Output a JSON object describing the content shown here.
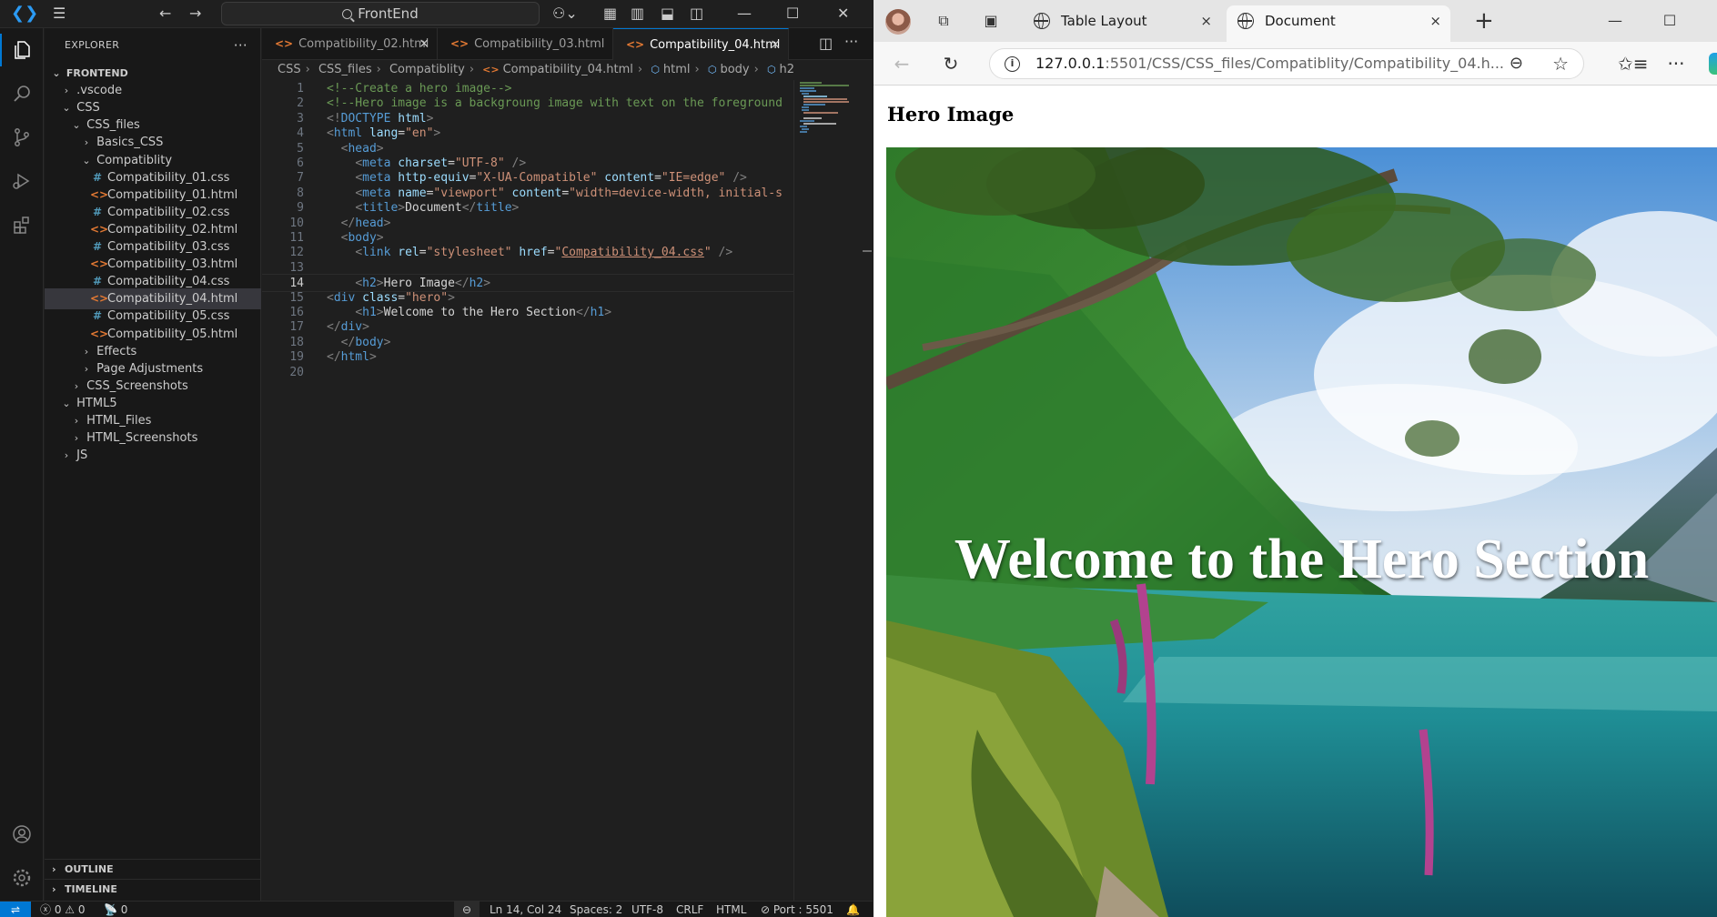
{
  "vscode": {
    "command_center": "FrontEnd",
    "sidebar": {
      "title": "EXPLORER",
      "tree": [
        {
          "label": "FRONTEND",
          "kind": "root",
          "chev": "⌄"
        },
        {
          "label": ".vscode",
          "kind": "folder",
          "chev": "›"
        },
        {
          "label": "CSS",
          "kind": "folder",
          "chev": "⌄"
        },
        {
          "label": "CSS_files",
          "kind": "folder",
          "chev": "⌄"
        },
        {
          "label": "Basics_CSS",
          "kind": "folder",
          "chev": "›"
        },
        {
          "label": "Compatiblity",
          "kind": "folder",
          "chev": "⌄"
        },
        {
          "label": "Compatibility_01.css",
          "kind": "css"
        },
        {
          "label": "Compatibility_01.html",
          "kind": "html"
        },
        {
          "label": "Compatibility_02.css",
          "kind": "css"
        },
        {
          "label": "Compatibility_02.html",
          "kind": "html"
        },
        {
          "label": "Compatibility_03.css",
          "kind": "css"
        },
        {
          "label": "Compatibility_03.html",
          "kind": "html"
        },
        {
          "label": "Compatibility_04.css",
          "kind": "css"
        },
        {
          "label": "Compatibility_04.html",
          "kind": "html",
          "selected": true
        },
        {
          "label": "Compatibility_05.css",
          "kind": "css"
        },
        {
          "label": "Compatibility_05.html",
          "kind": "html"
        },
        {
          "label": "Effects",
          "kind": "folder",
          "chev": "›"
        },
        {
          "label": "Page Adjustments",
          "kind": "folder",
          "chev": "›"
        },
        {
          "label": "CSS_Screenshots",
          "kind": "folder",
          "chev": "›"
        },
        {
          "label": "HTML5",
          "kind": "folder",
          "chev": "⌄"
        },
        {
          "label": "HTML_Files",
          "kind": "folder",
          "chev": "›"
        },
        {
          "label": "HTML_Screenshots",
          "kind": "folder",
          "chev": "›"
        },
        {
          "label": "JS",
          "kind": "folder",
          "chev": "›"
        }
      ],
      "outline": "OUTLINE",
      "timeline": "TIMELINE"
    },
    "tabs": [
      {
        "label": "Compatibility_02.html",
        "close": "×"
      },
      {
        "label": "Compatibility_03.html",
        "close": ""
      },
      {
        "label": "Compatibility_04.html",
        "close": "×",
        "active": true
      }
    ],
    "breadcrumbs": [
      "CSS",
      "CSS_files",
      "Compatiblity",
      "Compatibility_04.html",
      "html",
      "body",
      "h2"
    ],
    "code_lines": [
      [
        [
          "c-com",
          "<!--Create a hero image-->"
        ]
      ],
      [
        [
          "c-com",
          "<!--Hero image is a backgroung image with text on the foreground"
        ]
      ],
      [
        [
          "c-brk",
          "<!"
        ],
        [
          "c-tag",
          "DOCTYPE"
        ],
        [
          "c-txt",
          " "
        ],
        [
          "c-att",
          "html"
        ],
        [
          "c-brk",
          ">"
        ]
      ],
      [
        [
          "c-brk",
          "<"
        ],
        [
          "c-tag",
          "html"
        ],
        [
          "c-txt",
          " "
        ],
        [
          "c-att",
          "lang"
        ],
        [
          "c-txt",
          "="
        ],
        [
          "c-str",
          "\"en\""
        ],
        [
          "c-brk",
          ">"
        ]
      ],
      [
        [
          "c-txt",
          "  "
        ],
        [
          "c-brk",
          "<"
        ],
        [
          "c-tag",
          "head"
        ],
        [
          "c-brk",
          ">"
        ]
      ],
      [
        [
          "c-txt",
          "    "
        ],
        [
          "c-brk",
          "<"
        ],
        [
          "c-tag",
          "meta"
        ],
        [
          "c-txt",
          " "
        ],
        [
          "c-att",
          "charset"
        ],
        [
          "c-txt",
          "="
        ],
        [
          "c-str",
          "\"UTF-8\""
        ],
        [
          "c-txt",
          " "
        ],
        [
          "c-brk",
          "/>"
        ]
      ],
      [
        [
          "c-txt",
          "    "
        ],
        [
          "c-brk",
          "<"
        ],
        [
          "c-tag",
          "meta"
        ],
        [
          "c-txt",
          " "
        ],
        [
          "c-att",
          "http-equiv"
        ],
        [
          "c-txt",
          "="
        ],
        [
          "c-str",
          "\"X-UA-Compatible\""
        ],
        [
          "c-txt",
          " "
        ],
        [
          "c-att",
          "content"
        ],
        [
          "c-txt",
          "="
        ],
        [
          "c-str",
          "\"IE=edge\""
        ],
        [
          "c-txt",
          " "
        ],
        [
          "c-brk",
          "/>"
        ]
      ],
      [
        [
          "c-txt",
          "    "
        ],
        [
          "c-brk",
          "<"
        ],
        [
          "c-tag",
          "meta"
        ],
        [
          "c-txt",
          " "
        ],
        [
          "c-att",
          "name"
        ],
        [
          "c-txt",
          "="
        ],
        [
          "c-str",
          "\"viewport\""
        ],
        [
          "c-txt",
          " "
        ],
        [
          "c-att",
          "content"
        ],
        [
          "c-txt",
          "="
        ],
        [
          "c-str",
          "\"width=device-width, initial-s"
        ]
      ],
      [
        [
          "c-txt",
          "    "
        ],
        [
          "c-brk",
          "<"
        ],
        [
          "c-tag",
          "title"
        ],
        [
          "c-brk",
          ">"
        ],
        [
          "c-txt",
          "Document"
        ],
        [
          "c-brk",
          "</"
        ],
        [
          "c-tag",
          "title"
        ],
        [
          "c-brk",
          ">"
        ]
      ],
      [
        [
          "c-txt",
          "  "
        ],
        [
          "c-brk",
          "</"
        ],
        [
          "c-tag",
          "head"
        ],
        [
          "c-brk",
          ">"
        ]
      ],
      [
        [
          "c-txt",
          "  "
        ],
        [
          "c-brk",
          "<"
        ],
        [
          "c-tag",
          "body"
        ],
        [
          "c-brk",
          ">"
        ]
      ],
      [
        [
          "c-txt",
          "    "
        ],
        [
          "c-brk",
          "<"
        ],
        [
          "c-tag",
          "link"
        ],
        [
          "c-txt",
          " "
        ],
        [
          "c-att",
          "rel"
        ],
        [
          "c-txt",
          "="
        ],
        [
          "c-str",
          "\"stylesheet\""
        ],
        [
          "c-txt",
          " "
        ],
        [
          "c-att",
          "href"
        ],
        [
          "c-txt",
          "="
        ],
        [
          "c-str",
          "\""
        ],
        [
          "c-lnk",
          "Compatibility_04.css"
        ],
        [
          "c-str",
          "\""
        ],
        [
          "c-txt",
          " "
        ],
        [
          "c-brk",
          "/>"
        ]
      ],
      [],
      [
        [
          "c-txt",
          "    "
        ],
        [
          "c-brk",
          "<"
        ],
        [
          "c-tag",
          "h2"
        ],
        [
          "c-brk",
          ">"
        ],
        [
          "c-txt",
          "Hero Image"
        ],
        [
          "c-brk",
          "</"
        ],
        [
          "c-tag",
          "h2"
        ],
        [
          "c-brk",
          ">"
        ]
      ],
      [
        [
          "c-brk",
          "<"
        ],
        [
          "c-tag",
          "div"
        ],
        [
          "c-txt",
          " "
        ],
        [
          "c-att",
          "class"
        ],
        [
          "c-txt",
          "="
        ],
        [
          "c-str",
          "\"hero\""
        ],
        [
          "c-brk",
          ">"
        ]
      ],
      [
        [
          "c-txt",
          "    "
        ],
        [
          "c-brk",
          "<"
        ],
        [
          "c-tag",
          "h1"
        ],
        [
          "c-brk",
          ">"
        ],
        [
          "c-txt",
          "Welcome to the Hero Section"
        ],
        [
          "c-brk",
          "</"
        ],
        [
          "c-tag",
          "h1"
        ],
        [
          "c-brk",
          ">"
        ]
      ],
      [
        [
          "c-brk",
          "</"
        ],
        [
          "c-tag",
          "div"
        ],
        [
          "c-brk",
          ">"
        ]
      ],
      [
        [
          "c-txt",
          "  "
        ],
        [
          "c-brk",
          "</"
        ],
        [
          "c-tag",
          "body"
        ],
        [
          "c-brk",
          ">"
        ]
      ],
      [
        [
          "c-brk",
          "</"
        ],
        [
          "c-tag",
          "html"
        ],
        [
          "c-brk",
          ">"
        ]
      ],
      []
    ],
    "current_line": 14,
    "status": {
      "errors": "0",
      "warnings": "0",
      "ports": "0",
      "position": "Ln 14, Col 24",
      "spaces": "Spaces: 2",
      "encoding": "UTF-8",
      "eol": "CRLF",
      "language": "HTML",
      "port": "Port : 5501"
    }
  },
  "browser": {
    "tabs": [
      {
        "label": "Table Layout",
        "close": "×"
      },
      {
        "label": "Document",
        "close": "×",
        "active": true
      }
    ],
    "new_tab": "+",
    "url_host": "127.0.0.1",
    "url_path": ":5501/CSS/CSS_files/Compatiblity/Compatibility_04.h...",
    "page": {
      "h2": "Hero Image",
      "h1": "Welcome to the Hero Section"
    }
  }
}
